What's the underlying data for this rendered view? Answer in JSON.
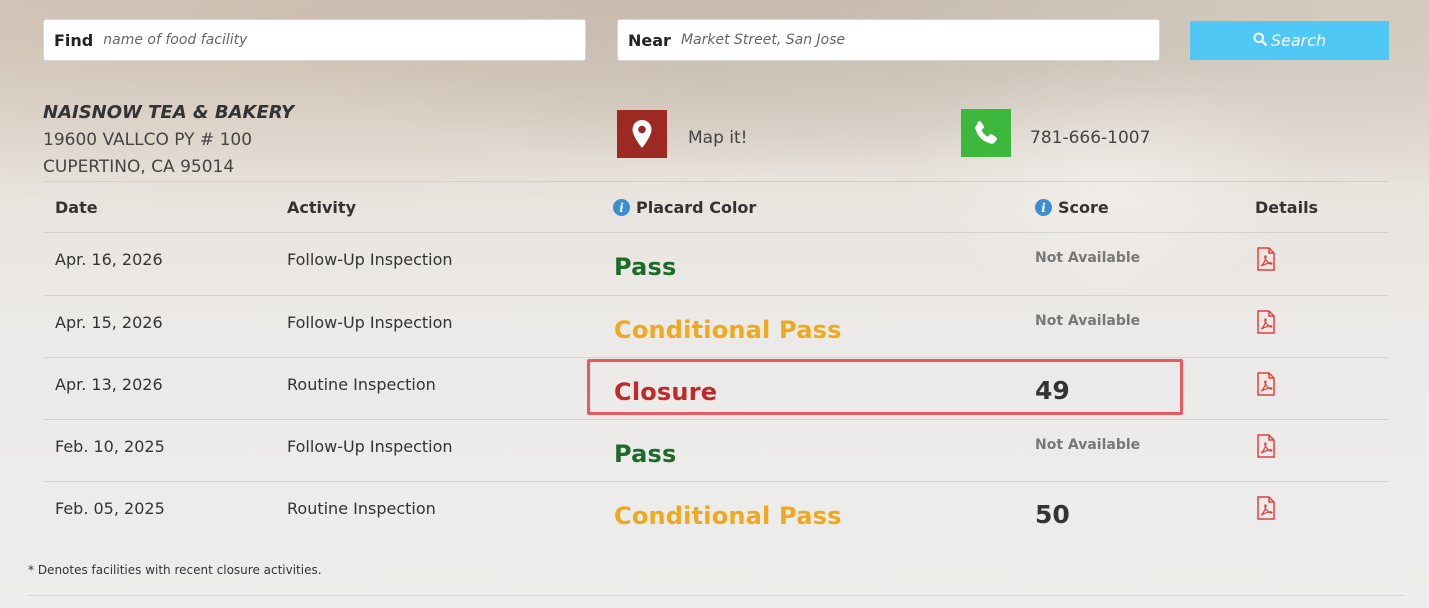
{
  "search": {
    "find_label": "Find",
    "find_placeholder": "name of food facility",
    "near_label": "Near",
    "near_placeholder": "Market Street, San Jose",
    "button_label": "Search"
  },
  "facility": {
    "name": "NAISNOW TEA & BAKERY",
    "address_line1": "19600 VALLCO PY # 100",
    "address_line2": "CUPERTINO, CA 95014",
    "map_label": "Map it!",
    "phone": "781-666-1007"
  },
  "table": {
    "headers": {
      "date": "Date",
      "activity": "Activity",
      "placard": "Placard Color",
      "score": "Score",
      "details": "Details"
    },
    "rows": [
      {
        "date": "Apr. 16, 2026",
        "activity": "Follow-Up Inspection",
        "placard": "Pass",
        "placard_type": "pass",
        "score": "Not Available"
      },
      {
        "date": "Apr. 15, 2026",
        "activity": "Follow-Up Inspection",
        "placard": "Conditional Pass",
        "placard_type": "cond",
        "score": "Not Available"
      },
      {
        "date": "Apr. 13, 2026",
        "activity": "Routine Inspection",
        "placard": "Closure",
        "placard_type": "closure",
        "score": "49"
      },
      {
        "date": "Feb. 10, 2025",
        "activity": "Follow-Up Inspection",
        "placard": "Pass",
        "placard_type": "pass",
        "score": "Not Available"
      },
      {
        "date": "Feb. 05, 2025",
        "activity": "Routine Inspection",
        "placard": "Conditional Pass",
        "placard_type": "cond",
        "score": "50"
      }
    ]
  },
  "footnote": "* Denotes facilities with recent closure activities.",
  "colors": {
    "pass": "#1d6b2a",
    "conditional_pass": "#f0a81c",
    "closure": "#c0282a",
    "search_button": "#4fc8f5",
    "map_tile": "#9c2a23",
    "phone_tile": "#3cb83c",
    "highlight_border": "#e85a5f",
    "pdf_icon": "#e0413e"
  },
  "icons": {
    "map": "map-pin-icon",
    "phone": "phone-icon",
    "search": "search-icon",
    "info": "info-icon",
    "details": "pdf-icon"
  }
}
